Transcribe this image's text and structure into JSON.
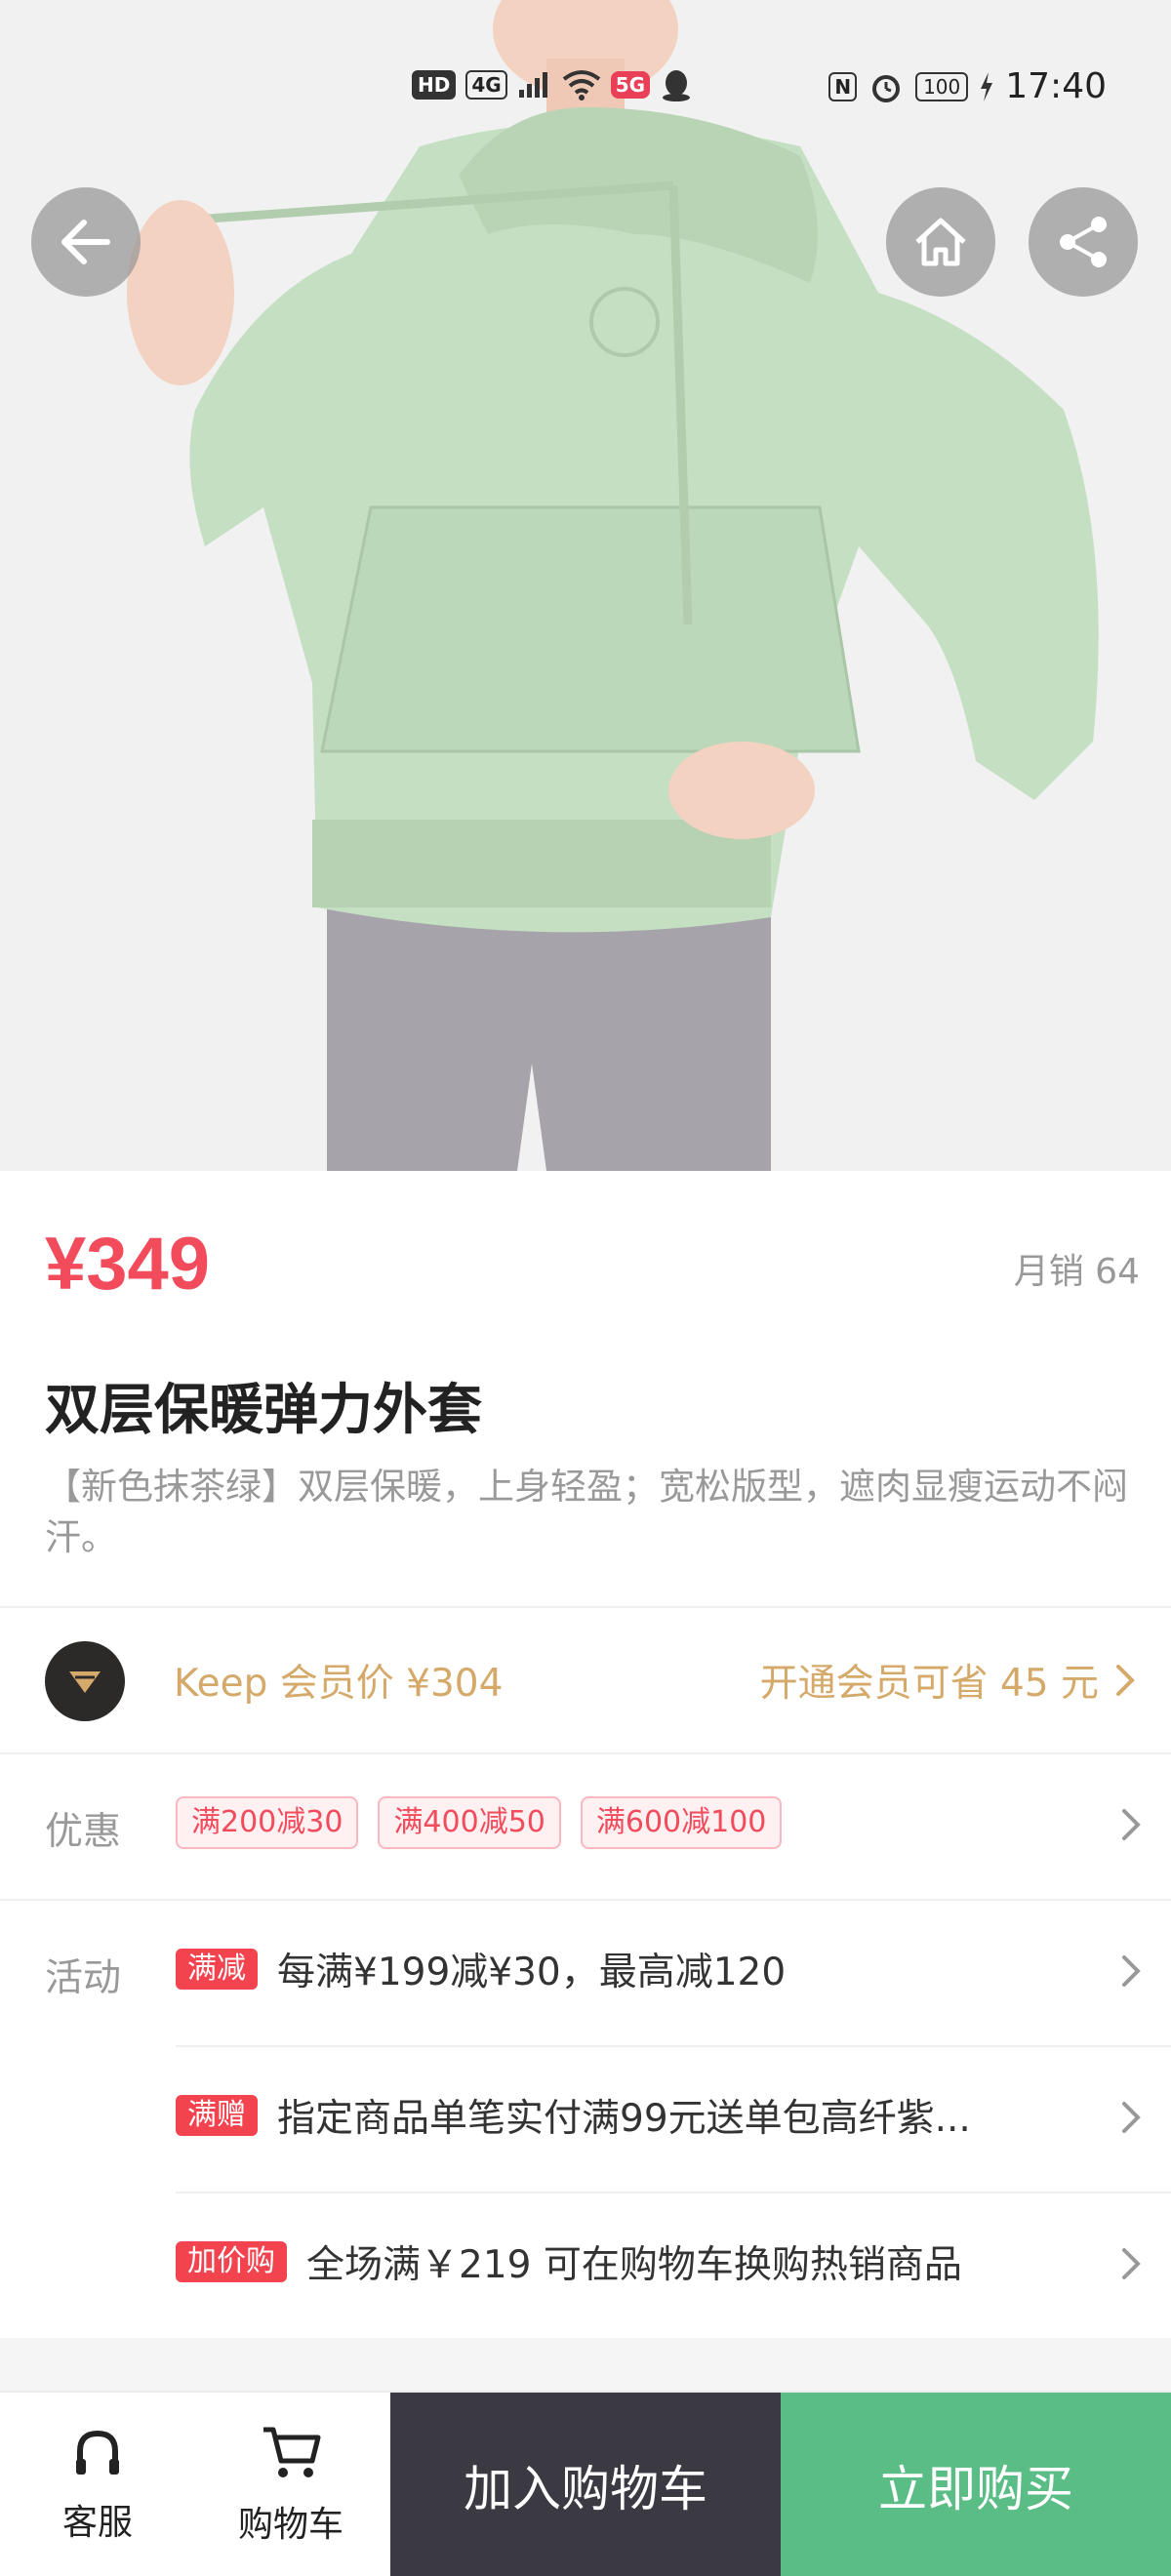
{
  "status_bar": {
    "left_chips": [
      "HD",
      "4G"
    ],
    "badge_5g": "5G",
    "nfc": "N",
    "battery": "100",
    "time": "17:40"
  },
  "nav": {
    "back_icon": "back-arrow-icon",
    "home_icon": "home-icon",
    "share_icon": "share-icon"
  },
  "product": {
    "price": "¥349",
    "monthly_sales": "月销 64",
    "title": "双层保暖弹力外套",
    "subtitle": "【新色抹茶绿】双层保暖，上身轻盈；宽松版型，遮肉显瘦运动不闷汗。",
    "image_colors": {
      "hoodie": "#c5dfc3",
      "leggings": "#a7a3ab",
      "background": "#f1f1f1"
    }
  },
  "member": {
    "label": "Keep 会员价 ¥304",
    "cta": "开通会员可省 45 元"
  },
  "discount": {
    "label": "优惠",
    "coupons": [
      "满200减30",
      "满400减50",
      "满600减100"
    ]
  },
  "activities": {
    "label": "活动",
    "items": [
      {
        "tag": "满减",
        "text": "每满¥199减¥30，最高减120"
      },
      {
        "tag": "满赠",
        "text": "指定商品单笔实付满99元送单包高纤紫..."
      },
      {
        "tag": "加价购",
        "text": "全场满￥219 可在购物车换购热销商品"
      }
    ]
  },
  "bottom_bar": {
    "service_label": "客服",
    "cart_label": "购物车",
    "add_to_cart": "加入购物车",
    "buy_now": "立即购买"
  },
  "colors": {
    "price": "#f24b5c",
    "member_gold": "#d4a96a",
    "tag_red": "#f2434f",
    "dark_button": "#3b3a42",
    "green_button": "#5bbd86"
  }
}
